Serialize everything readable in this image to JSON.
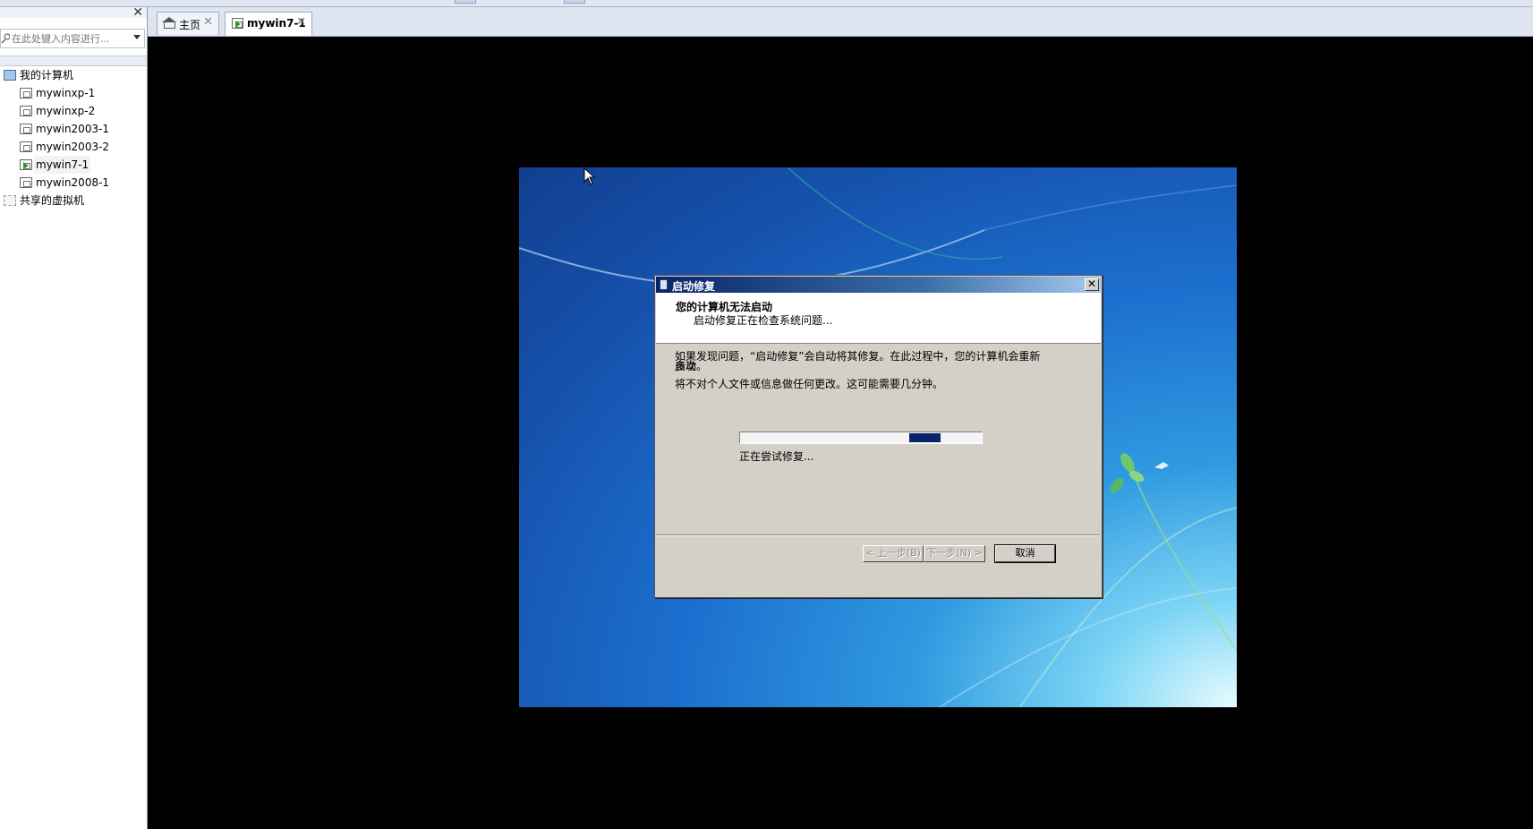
{
  "library": {
    "search": {
      "placeholder": "在此处键入内容进行..."
    },
    "close_label": "✕",
    "tree": {
      "root": "我的计算机",
      "vms": [
        "mywinxp-1",
        "mywinxp-2",
        "mywin2003-1",
        "mywin2003-2",
        "mywin7-1",
        "mywin2008-1"
      ],
      "selected_vm": "mywin7-1",
      "shared": "共享的虚拟机"
    }
  },
  "tabs": [
    {
      "label": "主页",
      "icon": "home-icon",
      "active": false
    },
    {
      "label": "mywin7-1",
      "icon": "vm-running-icon",
      "active": true
    }
  ],
  "tab_close_glyph": "✕",
  "dialog": {
    "title": "启动修复",
    "close_glyph": "✕",
    "heading": "您的计算机无法启动",
    "subheading": "启动修复正在检查系统问题...",
    "paragraph1_line1": "如果发现问题，“启动修复”会自动将其修复。在此过程中，您的计算机会重新启动",
    "paragraph1_line2": "多次。",
    "paragraph2": "将不对个人文件或信息做任何更改。这可能需要几分钟。",
    "progress": {
      "marquee_position": 0.7,
      "marquee_width": 0.13
    },
    "status": "正在尝试修复...",
    "buttons": {
      "back": "< 上一步(B)",
      "next": "下一步(N) >",
      "cancel": "取消"
    }
  },
  "colors": {
    "console_bg": "#000000",
    "dialog_face": "#d4d0c8",
    "titlebar_start": "#0a246a",
    "titlebar_end": "#a6caf0",
    "progress_fill": "#0a246a",
    "desktop_blue": "#1c6fcf"
  }
}
